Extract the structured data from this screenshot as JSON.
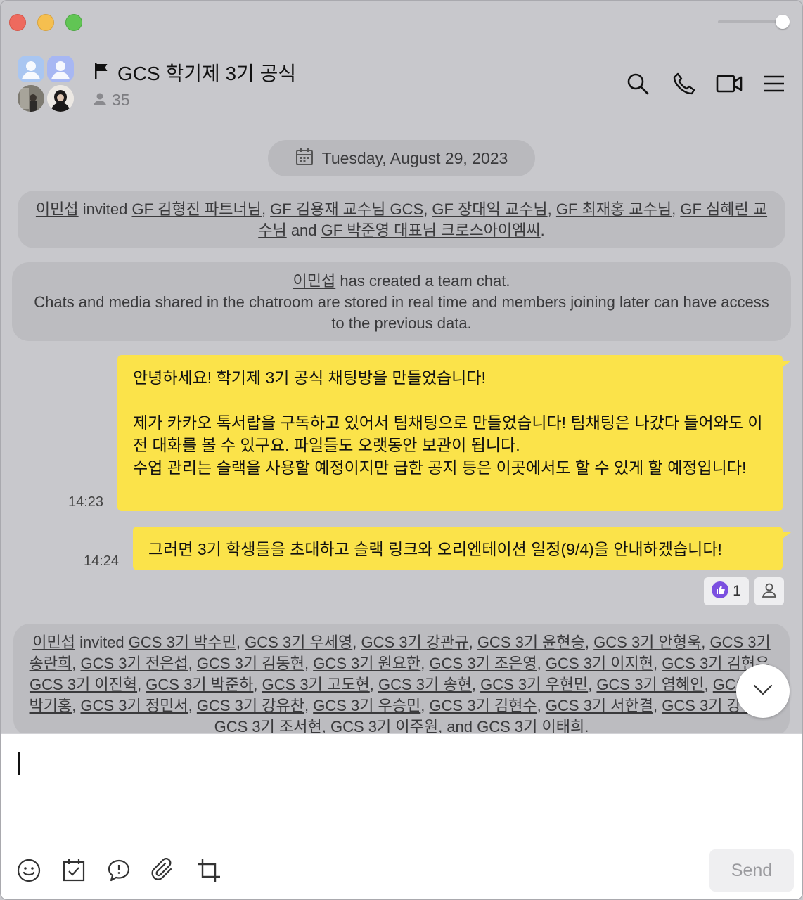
{
  "window": {
    "title": "GCS 학기제 3기 공식"
  },
  "header": {
    "chat_title": "GCS 학기제 3기 공식",
    "member_count": "35",
    "icons": [
      "search-icon",
      "call-icon",
      "video-call-icon",
      "menu-icon"
    ]
  },
  "chat": {
    "date_divider": "Tuesday, August 29, 2023",
    "system_invite_1": {
      "parts": [
        {
          "t": "이민섭",
          "link": true
        },
        {
          "t": " invited ",
          "link": false
        },
        {
          "t": "GF 김형진 파트너님",
          "link": true
        },
        {
          "t": ", ",
          "link": false
        },
        {
          "t": "GF 김용재 교수님 GCS",
          "link": true
        },
        {
          "t": ", ",
          "link": false
        },
        {
          "t": "GF 장대익 교수님",
          "link": true
        },
        {
          "t": ", ",
          "link": false
        },
        {
          "t": "GF 최재홍 교수님",
          "link": true
        },
        {
          "t": ", ",
          "link": false
        },
        {
          "t": "GF 심혜린 교수님",
          "link": true
        },
        {
          "t": " and ",
          "link": false
        },
        {
          "t": "GF 박준영 대표님 크로스아이엠씨",
          "link": true
        },
        {
          "t": ".",
          "link": false
        }
      ]
    },
    "system_created": {
      "creator": "이민섭",
      "line1_suffix": " has created a team chat.",
      "line2": "Chats and media shared in the chatroom are stored in real time and members joining later can have access to the previous data."
    },
    "messages": [
      {
        "time": "14:23",
        "lines": [
          "안녕하세요! 학기제 3기 공식 채팅방을 만들었습니다!",
          "",
          "제가 카카오 톡서랍을 구독하고 있어서 팀채팅으로 만들었습니다! 팀채팅은 나갔다 들어와도 이전 대화를 볼 수 있구요. 파일들도 오랫동안 보관이 됩니다.",
          "수업 관리는 슬랙을 사용할 예정이지만 급한 공지 등은 이곳에서도 할 수 있게 할 예정입니다!"
        ]
      },
      {
        "time": "14:24",
        "lines": [
          "그러면 3기 학생들을 초대하고 슬랙 링크와 오리엔테이션 일정(9/4)을 안내하겠습니다!"
        ]
      }
    ],
    "reaction": {
      "icon": "thumbs-up-icon",
      "count": "1"
    },
    "system_invite_2": {
      "inviter": "이민섭",
      "verb": " invited ",
      "names": [
        "GCS 3기 박수민",
        "GCS 3기 우세영",
        "GCS 3기 강관규",
        "GCS 3기 윤현승",
        "GCS 3기 안형욱",
        "GCS 3기 송란희",
        "GCS 3기 전은섭",
        "GCS 3기 김동현",
        "GCS 3기 원요한",
        "GCS 3기 조은영",
        "GCS 3기 이지현",
        "GCS 3기 김현우",
        "GCS 3기 이진혁",
        "GCS 3기 박준하",
        "GCS 3기 고도현",
        "GCS 3기 송현",
        "GCS 3기 우현민",
        "GCS 3기 염혜인",
        "GCS 3기 박기홍",
        "GCS 3기 정민서",
        "GCS 3기 강유찬",
        "GCS 3기 우승민",
        "GCS 3기 김현수",
        "GCS 3기 서한결",
        "GCS 3기 강예은",
        "GCS 3기 조서현",
        "GCS 3기 이주원"
      ],
      "last_joiner": " and ",
      "last_name": "GCS 3기 이태희",
      "end": "."
    }
  },
  "composer": {
    "input_value": "",
    "send_label": "Send",
    "tools": [
      "emoji-icon",
      "calendar-icon",
      "speech-bubble-icon",
      "attachment-icon",
      "crop-icon"
    ]
  },
  "colors": {
    "bubble": "#fbe34a",
    "background": "#c8c8cc",
    "system_pill": "#bcbcc0"
  }
}
